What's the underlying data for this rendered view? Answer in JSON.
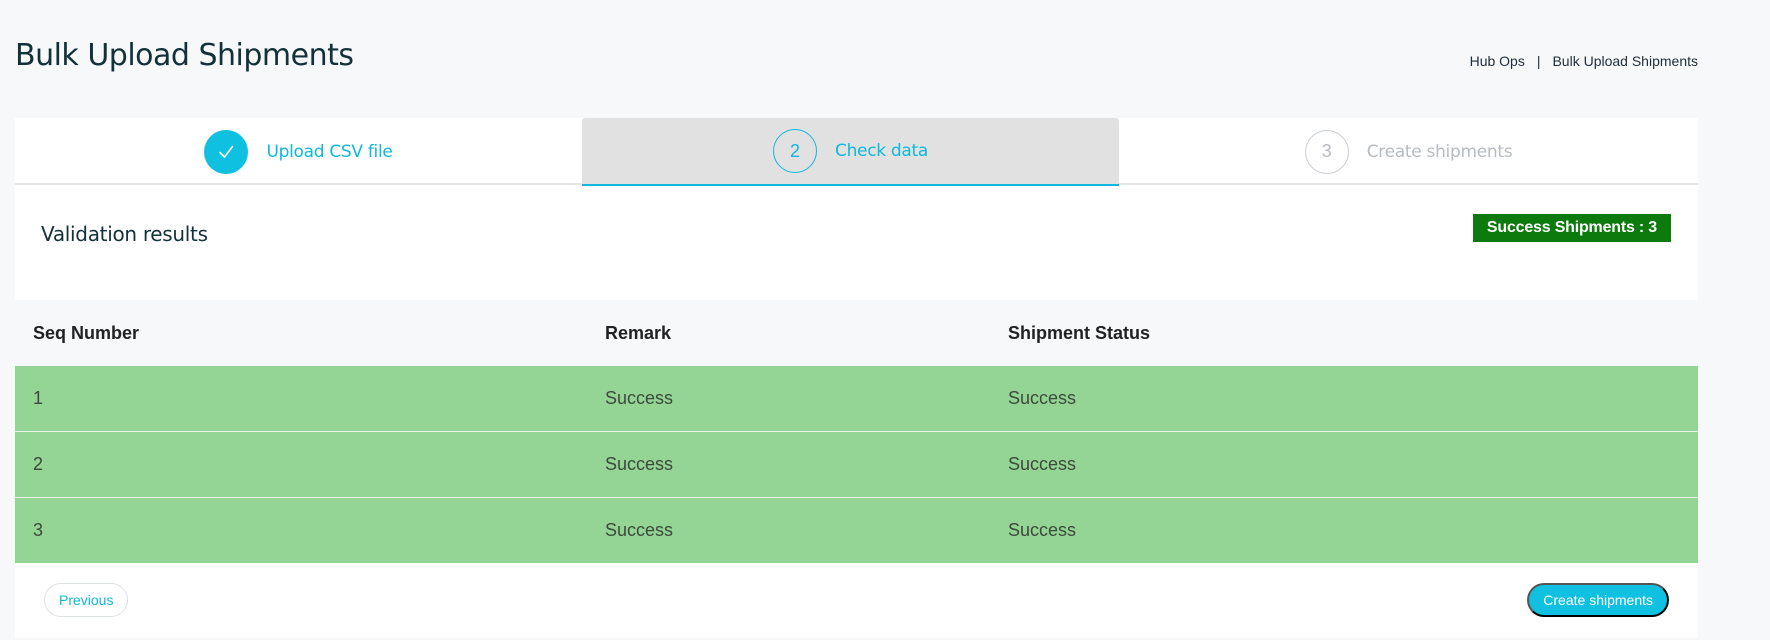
{
  "header": {
    "title": "Bulk Upload Shipments",
    "breadcrumb": [
      "Hub Ops",
      "Bulk Upload Shipments"
    ],
    "breadcrumb_separator": "|"
  },
  "stepper": {
    "steps": [
      {
        "number": "",
        "label": "Upload CSV file",
        "state": "completed",
        "icon": "check-icon"
      },
      {
        "number": "2",
        "label": "Check data",
        "state": "active"
      },
      {
        "number": "3",
        "label": "Create shipments",
        "state": "pending"
      }
    ]
  },
  "validation": {
    "title": "Validation results",
    "badge": "Success Shipments : 3",
    "badge_color": "#0d7a0d"
  },
  "table": {
    "columns": [
      "Seq Number",
      "Remark",
      "Shipment Status"
    ],
    "rows": [
      {
        "seq": "1",
        "remark": "Success",
        "status": "Success"
      },
      {
        "seq": "2",
        "remark": "Success",
        "status": "Success"
      },
      {
        "seq": "3",
        "remark": "Success",
        "status": "Success"
      }
    ],
    "row_color": "#94d494"
  },
  "footer": {
    "previous_label": "Previous",
    "create_label": "Create shipments"
  },
  "colors": {
    "accent": "#0fc0e0",
    "background": "#f7f8fa"
  }
}
